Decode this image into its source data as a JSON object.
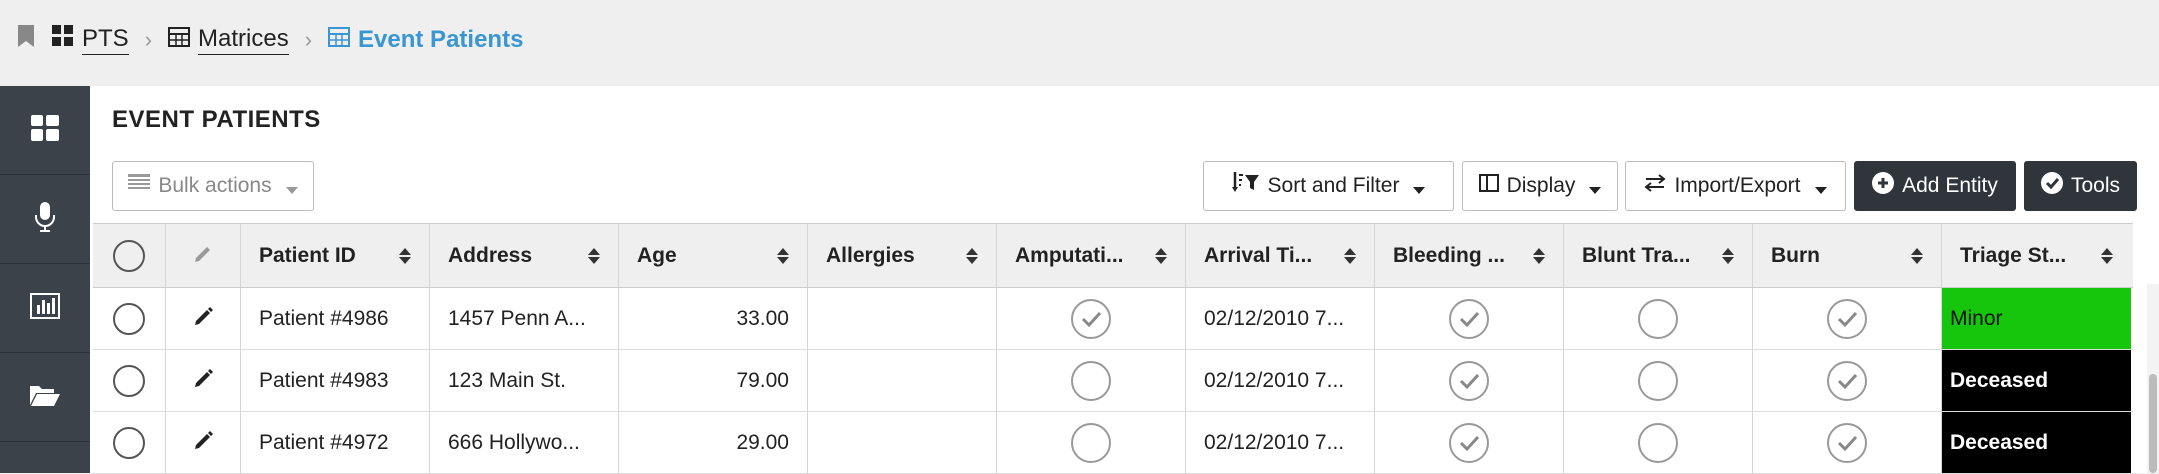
{
  "breadcrumbs": [
    {
      "label": "PTS",
      "icon": "grid-icon"
    },
    {
      "label": "Matrices",
      "icon": "table-icon"
    },
    {
      "label": "Event Patients",
      "icon": "table-icon"
    }
  ],
  "sidebar": {
    "items": [
      {
        "name": "dashboard-icon"
      },
      {
        "name": "microphone-icon"
      },
      {
        "name": "chart-icon"
      },
      {
        "name": "folder-open-icon"
      }
    ]
  },
  "page": {
    "title": "EVENT PATIENTS"
  },
  "toolbar": {
    "bulk_actions": "Bulk actions",
    "sort_filter": "Sort and Filter",
    "display": "Display",
    "import_export": "Import/Export",
    "add_entity": "Add Entity",
    "tools": "Tools"
  },
  "table": {
    "columns": [
      "Patient ID",
      "Address",
      "Age",
      "Allergies",
      "Amputati...",
      "Arrival Ti...",
      "Bleeding ...",
      "Blunt Tra...",
      "Burn",
      "Triage St..."
    ],
    "rows": [
      {
        "patient_id": "Patient #4986",
        "address": "1457 Penn A...",
        "age": "33.00",
        "allergies": "",
        "amputation": true,
        "arrival": "02/12/2010 7...",
        "bleeding": true,
        "blunt": false,
        "burn": true,
        "triage": "Minor"
      },
      {
        "patient_id": "Patient #4983",
        "address": "123 Main St.",
        "age": "79.00",
        "allergies": "",
        "amputation": false,
        "arrival": "02/12/2010 7...",
        "bleeding": true,
        "blunt": false,
        "burn": true,
        "triage": "Deceased"
      },
      {
        "patient_id": "Patient #4972",
        "address": "666 Hollywo...",
        "age": "29.00",
        "allergies": "",
        "amputation": false,
        "arrival": "02/12/2010 7...",
        "bleeding": true,
        "blunt": false,
        "burn": true,
        "triage": "Deceased"
      }
    ]
  },
  "colors": {
    "triage_minor": "#16c60c",
    "triage_deceased": "#000000",
    "link_active": "#3a96d2",
    "sidebar_bg": "#3b4249",
    "dark_button": "#2f353b"
  }
}
